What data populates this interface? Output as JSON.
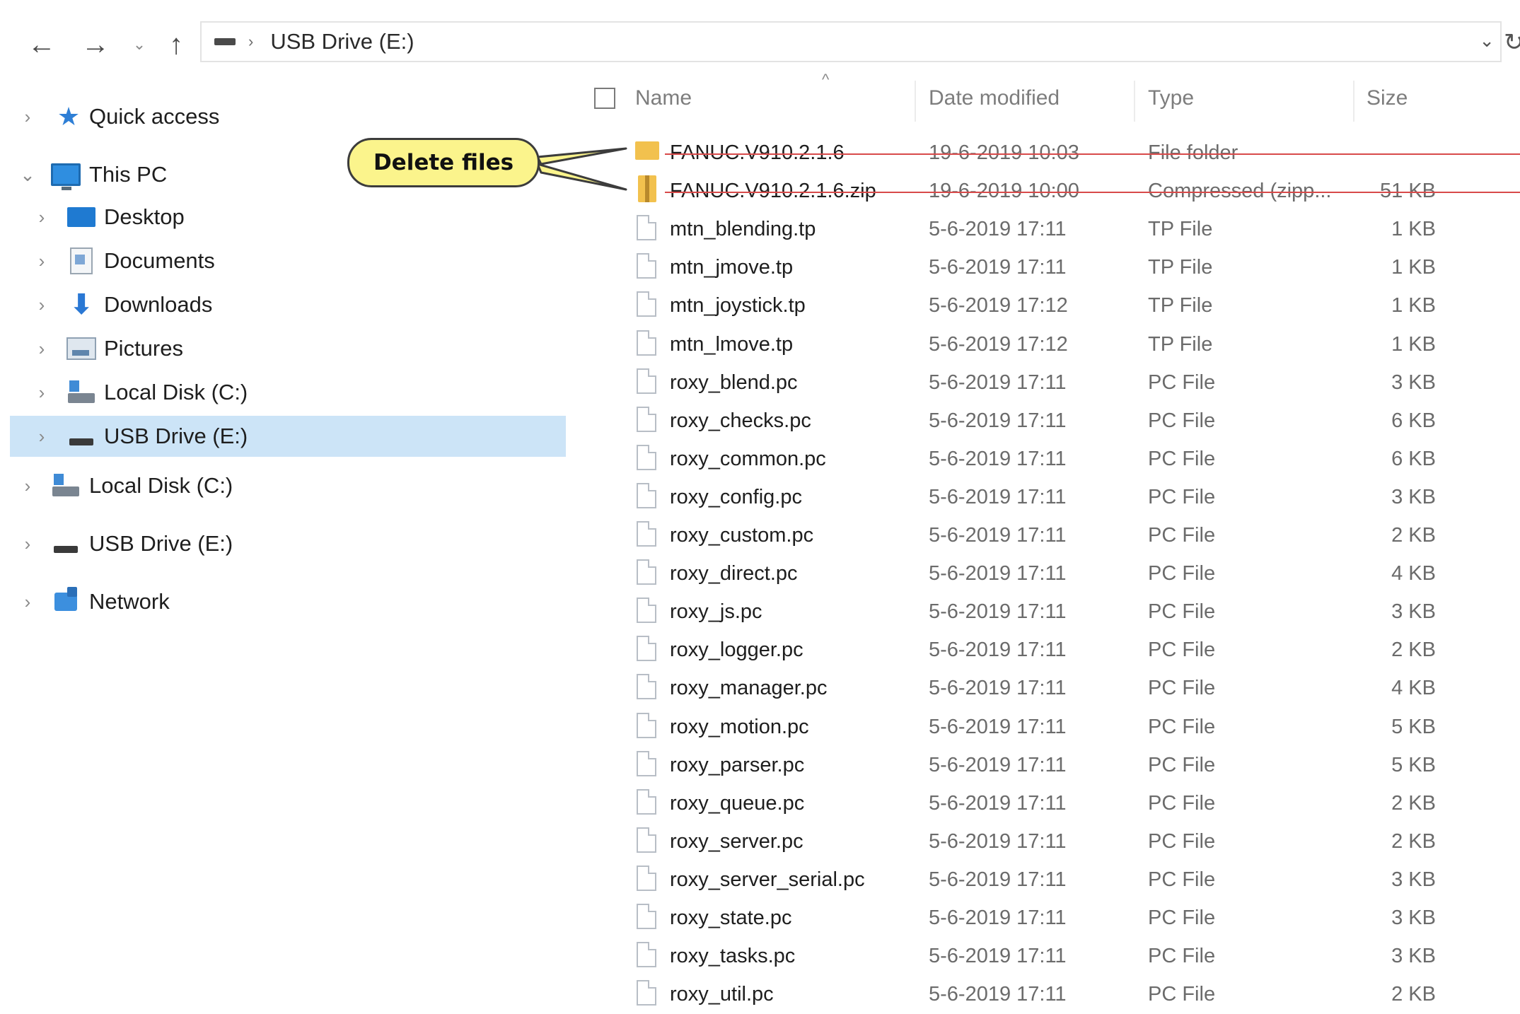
{
  "toolbar": {
    "back_icon": "arrow-left-icon",
    "forward_icon": "arrow-right-icon",
    "recent_icon": "chevron-down-icon",
    "up_icon": "arrow-up-icon",
    "address": "USB Drive (E:)",
    "separator": "›",
    "dropdown_icon": "chevron-down-icon",
    "refresh_icon": "refresh-icon"
  },
  "sidebar": {
    "items": [
      {
        "label": "Quick access",
        "icon": "star-icon"
      },
      {
        "label": "This PC",
        "icon": "monitor-icon"
      },
      {
        "label": "Desktop",
        "icon": "desktop-icon"
      },
      {
        "label": "Documents",
        "icon": "documents-icon"
      },
      {
        "label": "Downloads",
        "icon": "download-icon"
      },
      {
        "label": "Pictures",
        "icon": "pictures-icon"
      },
      {
        "label": "Local Disk (C:)",
        "icon": "disk-icon"
      },
      {
        "label": "USB Drive (E:)",
        "icon": "usb-drive-icon",
        "selected": true
      },
      {
        "label": "Local Disk (C:)",
        "icon": "disk-icon"
      },
      {
        "label": "USB Drive (E:)",
        "icon": "usb-drive-icon"
      },
      {
        "label": "Network",
        "icon": "network-icon"
      }
    ]
  },
  "columns": {
    "name": "Name",
    "date": "Date modified",
    "type": "Type",
    "size": "Size"
  },
  "files": [
    {
      "name": "FANUC.V910.2.1.6",
      "date": "19-6-2019 10:03",
      "type": "File folder",
      "size": "",
      "kind": "folder",
      "struck": true
    },
    {
      "name": "FANUC.V910.2.1.6.zip",
      "date": "19-6-2019 10:00",
      "type": "Compressed (zipp...",
      "size": "51 KB",
      "kind": "zip",
      "struck": true
    },
    {
      "name": "mtn_blending.tp",
      "date": "5-6-2019 17:11",
      "type": "TP File",
      "size": "1 KB",
      "kind": "file"
    },
    {
      "name": "mtn_jmove.tp",
      "date": "5-6-2019 17:11",
      "type": "TP File",
      "size": "1 KB",
      "kind": "file"
    },
    {
      "name": "mtn_joystick.tp",
      "date": "5-6-2019 17:12",
      "type": "TP File",
      "size": "1 KB",
      "kind": "file"
    },
    {
      "name": "mtn_lmove.tp",
      "date": "5-6-2019 17:12",
      "type": "TP File",
      "size": "1 KB",
      "kind": "file"
    },
    {
      "name": "roxy_blend.pc",
      "date": "5-6-2019 17:11",
      "type": "PC File",
      "size": "3 KB",
      "kind": "file"
    },
    {
      "name": "roxy_checks.pc",
      "date": "5-6-2019 17:11",
      "type": "PC File",
      "size": "6 KB",
      "kind": "file"
    },
    {
      "name": "roxy_common.pc",
      "date": "5-6-2019 17:11",
      "type": "PC File",
      "size": "6 KB",
      "kind": "file"
    },
    {
      "name": "roxy_config.pc",
      "date": "5-6-2019 17:11",
      "type": "PC File",
      "size": "3 KB",
      "kind": "file"
    },
    {
      "name": "roxy_custom.pc",
      "date": "5-6-2019 17:11",
      "type": "PC File",
      "size": "2 KB",
      "kind": "file"
    },
    {
      "name": "roxy_direct.pc",
      "date": "5-6-2019 17:11",
      "type": "PC File",
      "size": "4 KB",
      "kind": "file"
    },
    {
      "name": "roxy_js.pc",
      "date": "5-6-2019 17:11",
      "type": "PC File",
      "size": "3 KB",
      "kind": "file"
    },
    {
      "name": "roxy_logger.pc",
      "date": "5-6-2019 17:11",
      "type": "PC File",
      "size": "2 KB",
      "kind": "file"
    },
    {
      "name": "roxy_manager.pc",
      "date": "5-6-2019 17:11",
      "type": "PC File",
      "size": "4 KB",
      "kind": "file"
    },
    {
      "name": "roxy_motion.pc",
      "date": "5-6-2019 17:11",
      "type": "PC File",
      "size": "5 KB",
      "kind": "file"
    },
    {
      "name": "roxy_parser.pc",
      "date": "5-6-2019 17:11",
      "type": "PC File",
      "size": "5 KB",
      "kind": "file"
    },
    {
      "name": "roxy_queue.pc",
      "date": "5-6-2019 17:11",
      "type": "PC File",
      "size": "2 KB",
      "kind": "file"
    },
    {
      "name": "roxy_server.pc",
      "date": "5-6-2019 17:11",
      "type": "PC File",
      "size": "2 KB",
      "kind": "file"
    },
    {
      "name": "roxy_server_serial.pc",
      "date": "5-6-2019 17:11",
      "type": "PC File",
      "size": "3 KB",
      "kind": "file"
    },
    {
      "name": "roxy_state.pc",
      "date": "5-6-2019 17:11",
      "type": "PC File",
      "size": "3 KB",
      "kind": "file"
    },
    {
      "name": "roxy_tasks.pc",
      "date": "5-6-2019 17:11",
      "type": "PC File",
      "size": "3 KB",
      "kind": "file"
    },
    {
      "name": "roxy_util.pc",
      "date": "5-6-2019 17:11",
      "type": "PC File",
      "size": "2 KB",
      "kind": "file"
    }
  ],
  "callout": {
    "text": "Delete files"
  },
  "colors": {
    "selection": "#cce4f7",
    "strike": "#d84a4a",
    "callout_fill": "#fbf48c",
    "folder": "#f2c14e"
  }
}
